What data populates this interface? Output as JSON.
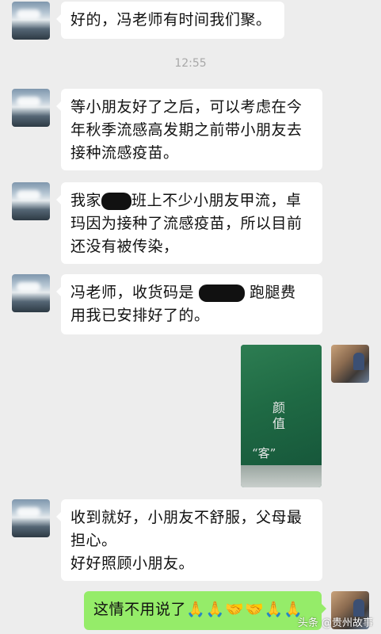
{
  "messages": [
    {
      "text": "好的，冯老师有时间我们聚。"
    },
    {
      "lines": [
        "等小朋友好了之后，可以考虑在今",
        "年秋季流感高发期之前带小朋友去",
        "接种流感疫苗。"
      ]
    },
    {
      "line1_a": "我家",
      "line1_b": "班上不少小朋友甲流，卓",
      "line2": "玛因为接种了流感疫苗，所以目前",
      "line3": "还没有被传染，"
    },
    {
      "line1_a": "冯老师，收货码是",
      "line1_b": "跑腿费",
      "line2": "用我已安排好了的。"
    },
    {
      "photo_text_vertical": "颜值",
      "photo_text_quote": "“客”"
    },
    {
      "lines": [
        "收到就好，小朋友不舒服，父母最",
        "担心。",
        "好好照顾小朋友。"
      ]
    },
    {
      "text": "这情不用说了",
      "emoji": "🙏🙏🤝🤝🙏🙏"
    }
  ],
  "timestamp": "12:55",
  "watermark": "头条 @贵州故事",
  "colors": {
    "bg": "#ededed",
    "incoming": "#ffffff",
    "outgoing": "#95ec69"
  }
}
